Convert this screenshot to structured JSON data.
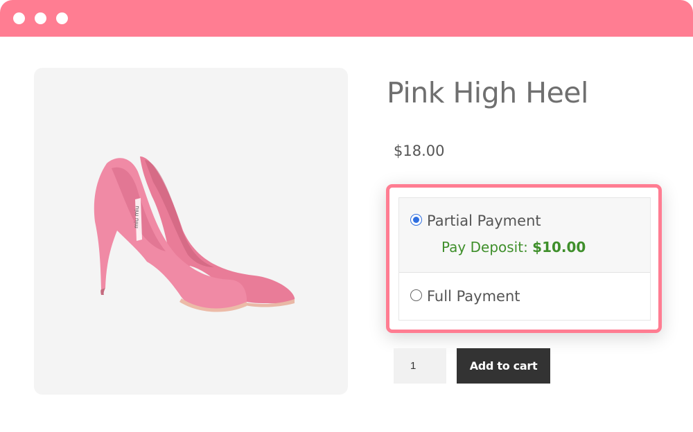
{
  "window": {
    "controls": [
      "window-dot",
      "window-dot",
      "window-dot"
    ],
    "colors": {
      "bar": "#ff7d92",
      "accent_border": "#ff7d92"
    }
  },
  "product": {
    "title": "Pink High Heel",
    "price": "$18.00",
    "image": {
      "subject": "pink suede high heel pumps",
      "brand_imprint": "miu miu"
    }
  },
  "payment": {
    "options": [
      {
        "label": "Partial Payment",
        "selected": true
      },
      {
        "label": "Full Payment",
        "selected": false
      }
    ],
    "deposit_label": "Pay Deposit:",
    "deposit_amount": "$10.00",
    "colors": {
      "deposit_text": "#3f8f2b",
      "radio_selected": "#2f6fe0"
    }
  },
  "cart": {
    "quantity": "1",
    "add_to_cart_label": "Add to cart"
  }
}
